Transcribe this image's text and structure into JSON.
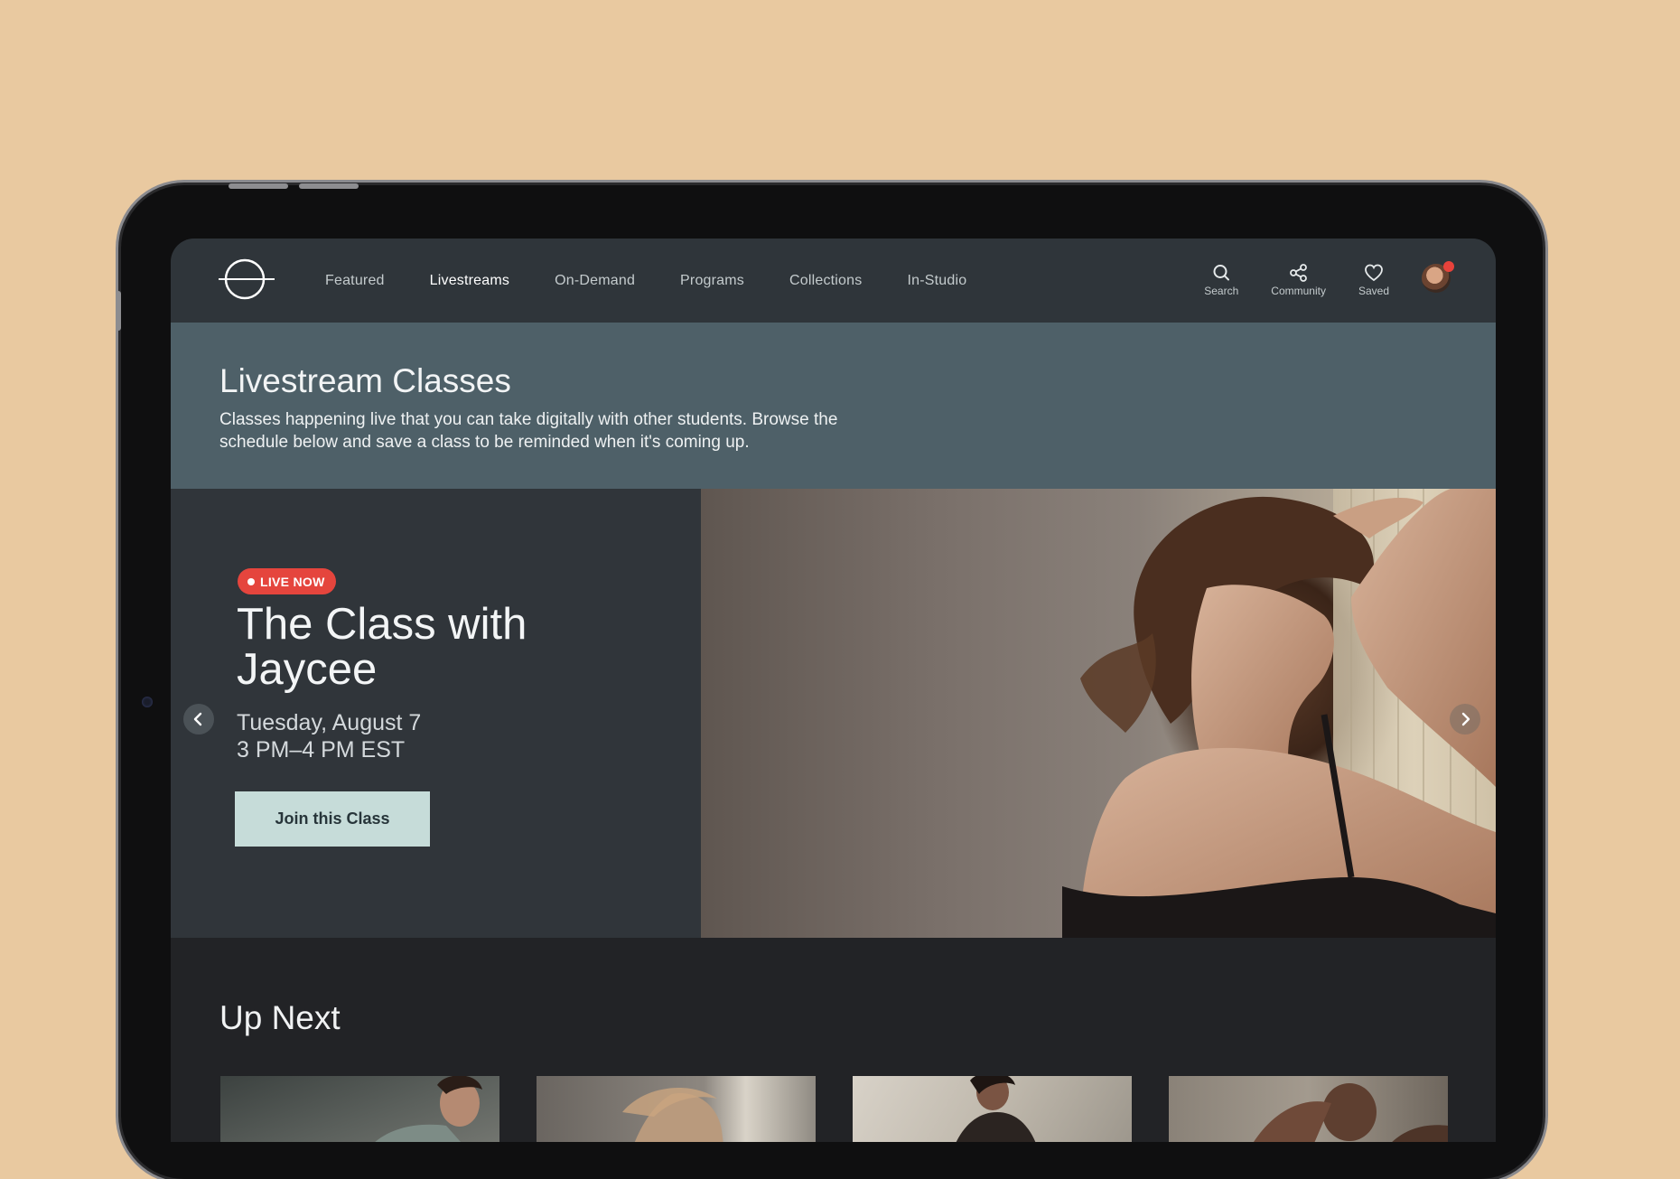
{
  "nav": {
    "logo_icon": "circle-line-logo",
    "links": [
      "Featured",
      "Livestreams",
      "On-Demand",
      "Programs",
      "Collections",
      "In-Studio"
    ],
    "active_link": "Livestreams",
    "actions": [
      {
        "label": "Search",
        "icon": "search-icon"
      },
      {
        "label": "Community",
        "icon": "share-network-icon"
      },
      {
        "label": "Saved",
        "icon": "heart-icon"
      }
    ],
    "avatar_notification": true
  },
  "intro": {
    "title": "Livestream Classes",
    "description": "Classes happening live that you can take digitally with other students. Browse the schedule below and save a class to be reminded when it's coming up."
  },
  "hero": {
    "badge": "LIVE NOW",
    "title": "The Class with Jaycee",
    "date": "Tuesday, August 7",
    "time": "3 PM–4 PM EST",
    "cta": "Join this Class"
  },
  "up_next": {
    "title": "Up Next"
  },
  "colors": {
    "background": "#e9c9a0",
    "nav": "#2f353a",
    "intro": "#4e6068",
    "hero_panel": "#30353a",
    "live_badge": "#e5453d",
    "cta": "#c6dcd9"
  }
}
